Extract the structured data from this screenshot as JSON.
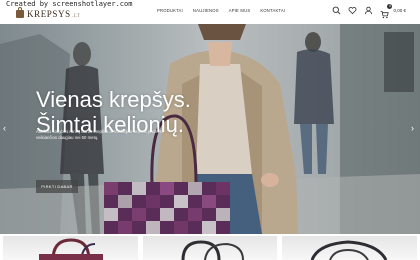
{
  "watermark": "Created by screenshotlayer.com",
  "brand": {
    "name": "KREPSYS",
    "tld": ".LT"
  },
  "nav": {
    "items": [
      "PRODUKTAI",
      "NAUJIENOS",
      "APIE MUS",
      "KONTAKTAI"
    ]
  },
  "header_icons": [
    "search-icon",
    "heart-icon",
    "user-icon",
    "cart-icon"
  ],
  "cart": {
    "count": "0",
    "total": "0,00 €"
  },
  "hero": {
    "title_line1": "Vienas krepšys.",
    "title_line2": "Šimtai kelionių.",
    "subtitle": "Aukštos kokybės rankų darbo krepšiai iš Vokietijos šeimos įmonės, veikiančios daugiau nei 50 metų.",
    "button_label": "PIRKTI DABAR"
  },
  "colors": {
    "accent": "#333333",
    "hero_text": "#ffffff",
    "brand_brown": "#7a5a3a"
  }
}
